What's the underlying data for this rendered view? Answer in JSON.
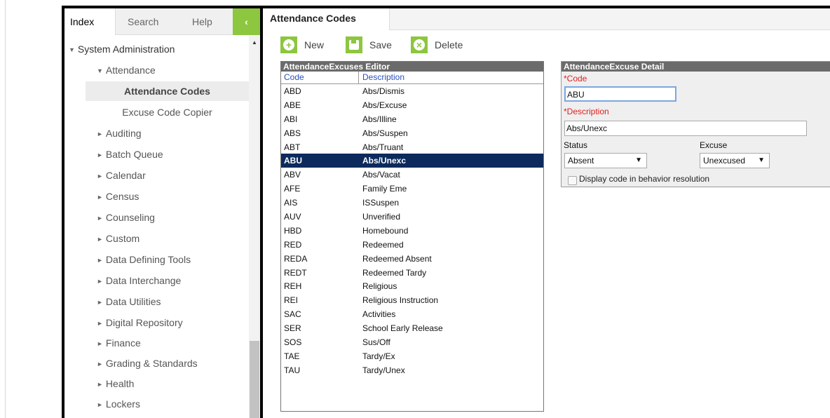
{
  "nav": {
    "tabs": [
      {
        "label": "Index"
      },
      {
        "label": "Search"
      },
      {
        "label": "Help"
      }
    ],
    "collapse_glyph": "‹",
    "tree": [
      {
        "label": "System Administration",
        "level": 0,
        "expanded": true
      },
      {
        "label": "Attendance",
        "level": 1,
        "expanded": true
      },
      {
        "label": "Attendance Codes",
        "level": 2,
        "selected": true
      },
      {
        "label": "Excuse Code Copier",
        "level": 2
      },
      {
        "label": "Auditing",
        "level": 1
      },
      {
        "label": "Batch Queue",
        "level": 1
      },
      {
        "label": "Calendar",
        "level": 1
      },
      {
        "label": "Census",
        "level": 1
      },
      {
        "label": "Counseling",
        "level": 1
      },
      {
        "label": "Custom",
        "level": 1
      },
      {
        "label": "Data Defining Tools",
        "level": 1
      },
      {
        "label": "Data Interchange",
        "level": 1
      },
      {
        "label": "Data Utilities",
        "level": 1
      },
      {
        "label": "Digital Repository",
        "level": 1
      },
      {
        "label": "Finance",
        "level": 1
      },
      {
        "label": "Grading & Standards",
        "level": 1
      },
      {
        "label": "Health",
        "level": 1
      },
      {
        "label": "Lockers",
        "level": 1
      }
    ],
    "arrow_expanded": "▼",
    "arrow_collapsed": "►"
  },
  "main": {
    "tab_title": "Attendance Codes",
    "toolbar": {
      "new_label": "New",
      "save_label": "Save",
      "delete_label": "Delete"
    },
    "accent_color": "#8dc63f",
    "editor": {
      "title": "AttendanceExcuses Editor",
      "col_code": "Code",
      "col_description": "Description",
      "rows": [
        {
          "code": "ABD",
          "description": "Abs/Dismis"
        },
        {
          "code": "ABE",
          "description": "Abs/Excuse"
        },
        {
          "code": "ABI",
          "description": "Abs/Illine"
        },
        {
          "code": "ABS",
          "description": "Abs/Suspen"
        },
        {
          "code": "ABT",
          "description": "Abs/Truant"
        },
        {
          "code": "ABU",
          "description": "Abs/Unexc",
          "selected": true
        },
        {
          "code": "ABV",
          "description": "Abs/Vacat"
        },
        {
          "code": "AFE",
          "description": "Family Eme"
        },
        {
          "code": "AIS",
          "description": "ISSuspen"
        },
        {
          "code": "AUV",
          "description": "Unverified"
        },
        {
          "code": "HBD",
          "description": "Homebound"
        },
        {
          "code": "RED",
          "description": "Redeemed"
        },
        {
          "code": "REDA",
          "description": "Redeemed Absent"
        },
        {
          "code": "REDT",
          "description": "Redeemed Tardy"
        },
        {
          "code": "REH",
          "description": "Religious"
        },
        {
          "code": "REI",
          "description": "Religious Instruction"
        },
        {
          "code": "SAC",
          "description": "Activities"
        },
        {
          "code": "SER",
          "description": "School Early Release"
        },
        {
          "code": "SOS",
          "description": "Sus/Off"
        },
        {
          "code": "TAE",
          "description": "Tardy/Ex"
        },
        {
          "code": "TAU",
          "description": "Tardy/Unex"
        }
      ]
    },
    "detail": {
      "title": "AttendanceExcuse Detail",
      "code_label": "*Code",
      "code_value": "ABU",
      "description_label": "*Description",
      "description_value": "Abs/Unexc",
      "status_label": "Status",
      "status_value": "Absent",
      "excuse_label": "Excuse",
      "excuse_value": "Unexcused",
      "checkbox_label": "Display code in behavior resolution",
      "checkbox_checked": false
    }
  }
}
